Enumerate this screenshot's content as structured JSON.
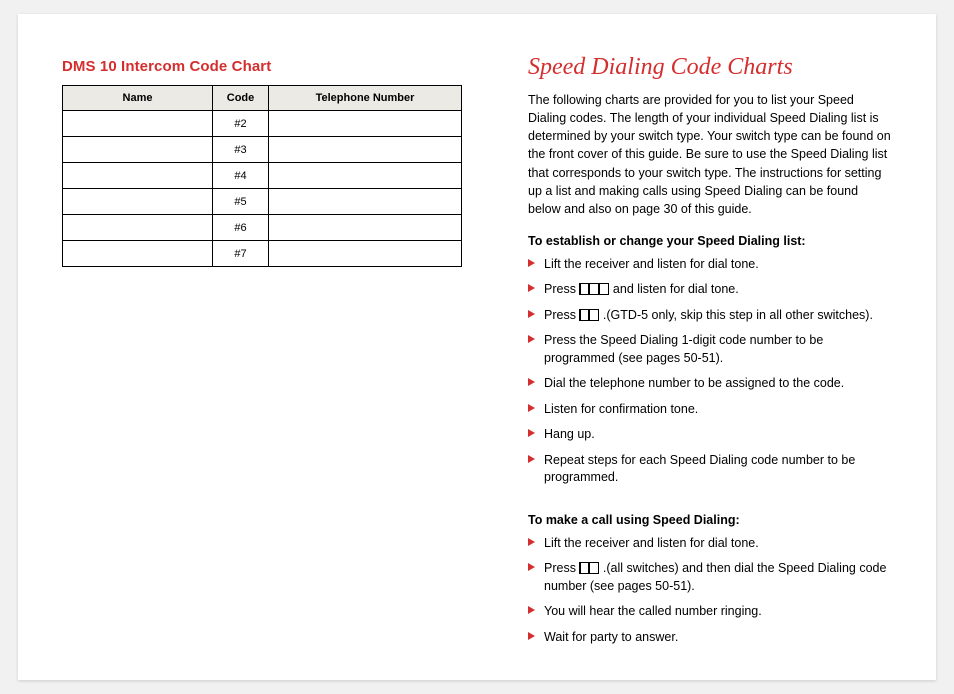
{
  "left": {
    "heading": "DMS 10 Intercom Code Chart",
    "table": {
      "headers": {
        "name": "Name",
        "code": "Code",
        "tel": "Telephone Number"
      },
      "rows": [
        {
          "name": "",
          "code": "#2",
          "tel": ""
        },
        {
          "name": "",
          "code": "#3",
          "tel": ""
        },
        {
          "name": "",
          "code": "#4",
          "tel": ""
        },
        {
          "name": "",
          "code": "#5",
          "tel": ""
        },
        {
          "name": "",
          "code": "#6",
          "tel": ""
        },
        {
          "name": "",
          "code": "#7",
          "tel": ""
        }
      ]
    }
  },
  "right": {
    "title": "Speed Dialing Code Charts",
    "intro": "The following charts are provided for you to list your Speed Dialing codes. The length of your individual Speed Dialing list is determined by your switch type. Your switch type can be found on the front cover of this guide. Be sure to use the Speed Dialing list that corresponds to your switch type. The instructions for setting up a list and making calls using Speed Dialing can be found below and also on page 30 of this guide.",
    "section1": {
      "heading": "To establish or change your Speed Dialing list:",
      "items": {
        "i0": "Lift the receiver and listen for dial tone.",
        "i1a": "Press ",
        "i1b": " and listen for dial tone.",
        "i2a": "Press ",
        "i2b": ".(GTD-5 only, skip this step in all other switches).",
        "i3": "Press the Speed Dialing 1-digit code number to be programmed (see pages 50-51).",
        "i4": "Dial the telephone number to be assigned to the code.",
        "i5": "Listen for confirmation tone.",
        "i6": "Hang up.",
        "i7": "Repeat steps for each Speed Dialing code number to be programmed."
      }
    },
    "section2": {
      "heading": "To make a call using Speed Dialing:",
      "items": {
        "i0": "Lift the receiver and listen for dial tone.",
        "i1a": "Press ",
        "i1b": ".(all switches) and then dial the Speed Dialing code number (see pages 50-51).",
        "i2": "You will hear the called number ringing.",
        "i3": "Wait for party to answer."
      }
    }
  }
}
